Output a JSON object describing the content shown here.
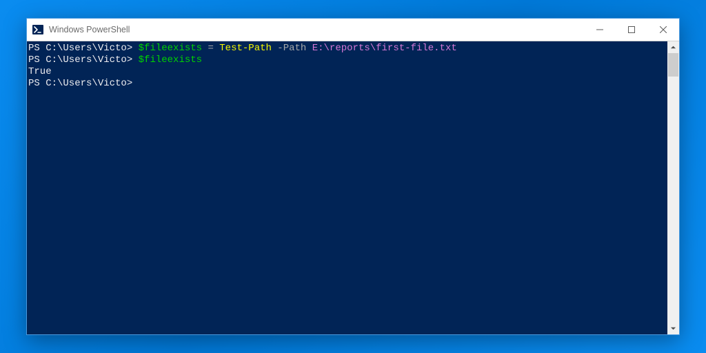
{
  "window": {
    "title": "Windows PowerShell"
  },
  "terminal": {
    "lines": [
      {
        "type": "cmd",
        "prompt": "PS C:\\Users\\Victo> ",
        "tokens": [
          {
            "cls": "tok-var",
            "text": "$fileexists"
          },
          {
            "cls": "tok-op",
            "text": " = "
          },
          {
            "cls": "tok-cmd",
            "text": "Test-Path"
          },
          {
            "cls": "tok-param",
            "text": " -Path "
          },
          {
            "cls": "tok-arg",
            "text": "E:\\reports\\first-file.txt"
          }
        ]
      },
      {
        "type": "cmd",
        "prompt": "PS C:\\Users\\Victo> ",
        "tokens": [
          {
            "cls": "tok-var",
            "text": "$fileexists"
          }
        ]
      },
      {
        "type": "output",
        "text": "True"
      },
      {
        "type": "cmd",
        "prompt": "PS C:\\Users\\Victo> ",
        "tokens": []
      }
    ]
  }
}
